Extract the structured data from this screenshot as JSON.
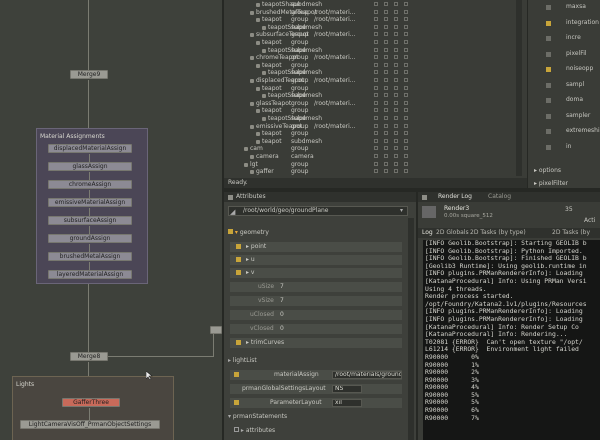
{
  "graph": {
    "merge9": "Merge9",
    "material_group": {
      "title": "Material Assignments",
      "items": [
        "displacedMaterialAssign",
        "glassAssign",
        "chromeAssign",
        "emissiveMaterialAssign",
        "subsurfaceAssign",
        "groundAssign",
        "brushedMetalAssign",
        "layeredMaterialAssign"
      ]
    },
    "merge8": "Merge8",
    "lights_group": {
      "title": "Lights",
      "gaffer": "GafferThree",
      "settings": "LightCameraVisOff_PrmanObjectSettings"
    }
  },
  "scene_graph": {
    "rows": [
      {
        "name": "teapotShape",
        "type": "subdmesh",
        "loc": "",
        "indent": 2
      },
      {
        "name": "brushedMetalTeapot",
        "type": "group",
        "loc": "/root/materi...",
        "indent": 1
      },
      {
        "name": "teapot",
        "type": "group",
        "loc": "/root/materi...",
        "indent": 2
      },
      {
        "name": "teapotShape",
        "type": "subdmesh",
        "loc": "",
        "indent": 3
      },
      {
        "name": "subsurfaceTeapot",
        "type": "group",
        "loc": "/root/materi...",
        "indent": 1
      },
      {
        "name": "teapot",
        "type": "group",
        "loc": "",
        "indent": 2
      },
      {
        "name": "teapotShape",
        "type": "subdmesh",
        "loc": "",
        "indent": 3
      },
      {
        "name": "chromeTeapot",
        "type": "group",
        "loc": "/root/materi...",
        "indent": 1
      },
      {
        "name": "teapot",
        "type": "group",
        "loc": "",
        "indent": 2
      },
      {
        "name": "teapotShape",
        "type": "subdmesh",
        "loc": "",
        "indent": 3
      },
      {
        "name": "displacedTeapot",
        "type": "group",
        "loc": "/root/materi...",
        "indent": 1
      },
      {
        "name": "teapot",
        "type": "group",
        "loc": "",
        "indent": 2
      },
      {
        "name": "teapotShape",
        "type": "subdmesh",
        "loc": "",
        "indent": 3
      },
      {
        "name": "glassTeapot",
        "type": "group",
        "loc": "/root/materi...",
        "indent": 1
      },
      {
        "name": "teapot",
        "type": "group",
        "loc": "",
        "indent": 2
      },
      {
        "name": "teapotShape",
        "type": "subdmesh",
        "loc": "",
        "indent": 3
      },
      {
        "name": "emissiveTeapot",
        "type": "group",
        "loc": "/root/materi...",
        "indent": 1
      },
      {
        "name": "teapot",
        "type": "group",
        "loc": "",
        "indent": 2
      },
      {
        "name": "teapot",
        "type": "subdmesh",
        "loc": "",
        "indent": 2
      },
      {
        "name": "cam",
        "type": "group",
        "loc": "",
        "indent": 0
      },
      {
        "name": "camera",
        "type": "camera",
        "loc": "",
        "indent": 1
      },
      {
        "name": "lgt",
        "type": "group",
        "loc": "",
        "indent": 0
      },
      {
        "name": "gaffer",
        "type": "group",
        "loc": "",
        "indent": 1
      }
    ],
    "status": "Ready."
  },
  "side_props": {
    "items": [
      "maxsa",
      "integration",
      "incre",
      "pixelFil",
      "noiseopp",
      "sampl",
      "doma",
      "sampler",
      "extremeshi",
      "in"
    ],
    "options": "options",
    "pixelfilter": "pixelFilter"
  },
  "attributes": {
    "title": "Attributes",
    "path": "/root/world/geo/groundPlane",
    "geometry": "geometry",
    "point": "point",
    "u": "u",
    "v": "v",
    "uSize_label": "uSize",
    "uSize": "7",
    "vSize_label": "vSize",
    "vSize": "7",
    "uClosed_label": "uClosed",
    "uClosed": "0",
    "vClosed_label": "vClosed",
    "vClosed": "0",
    "trimCurves": "trimCurves",
    "lightList": "lightList",
    "materialAssign_label": "materialAssign",
    "materialAssign": "/root/materials/ground",
    "prmanGlobal_label": "prmanGlobalSettingsLayout",
    "prmanGlobal": "NS",
    "paramLayout_label": "ParameterLayout",
    "paramLayout": "xil",
    "prmanStatements": "prmanStatements",
    "attributes_section": "attributes"
  },
  "render_log": {
    "tab_active": "Render Log",
    "tab_other": "Catalog",
    "render_name": "Render3",
    "render_sub": "0.00s  square_512",
    "num": "35",
    "actions": "Acti",
    "subtabs": [
      "Log",
      "2D Globals",
      "2D Tasks (by type)",
      "2D Tasks (by"
    ],
    "lines": [
      "[INFO Geolib.Bootstrap]: Starting GEOLIB b",
      "[INFO Geolib.Bootstrap]: Python Imported.",
      "[INFO Geolib.Bootstrap]: Finished GEOLIB b",
      "[Geolib3 Runtime]: Using geolib.runtime in",
      "[INFO plugins.PRManRendererInfo]: Loading",
      "[KatanaProcedural] Info: Using PRMan Versi",
      "Using 4 threads.",
      "Render process started.",
      "/opt/Foundry/Katana2.1v1/plugins/Resources",
      "[INFO plugins.PRManRendererInfo]: Loading",
      "[INFO plugins.PRManRendererInfo]: Loading",
      "[KatanaProcedural] Info: Render Setup Co",
      "[KatanaProcedural] Info: Rendering...",
      "T02081 {ERROR}  Can't open texture \"/opt/",
      "L61214 {ERROR}  Environment light failed",
      "R90000      0%",
      "R90000      1%",
      "R90000      2%",
      "R90000      3%",
      "R90000      4%",
      "R90000      5%",
      "R90000      5%",
      "R90000      6%",
      "R90000      7%"
    ]
  },
  "colors": {
    "group_border": "#6a6578",
    "accent_yellow": "#c8a53a",
    "node_orange": "#c86a5a"
  }
}
